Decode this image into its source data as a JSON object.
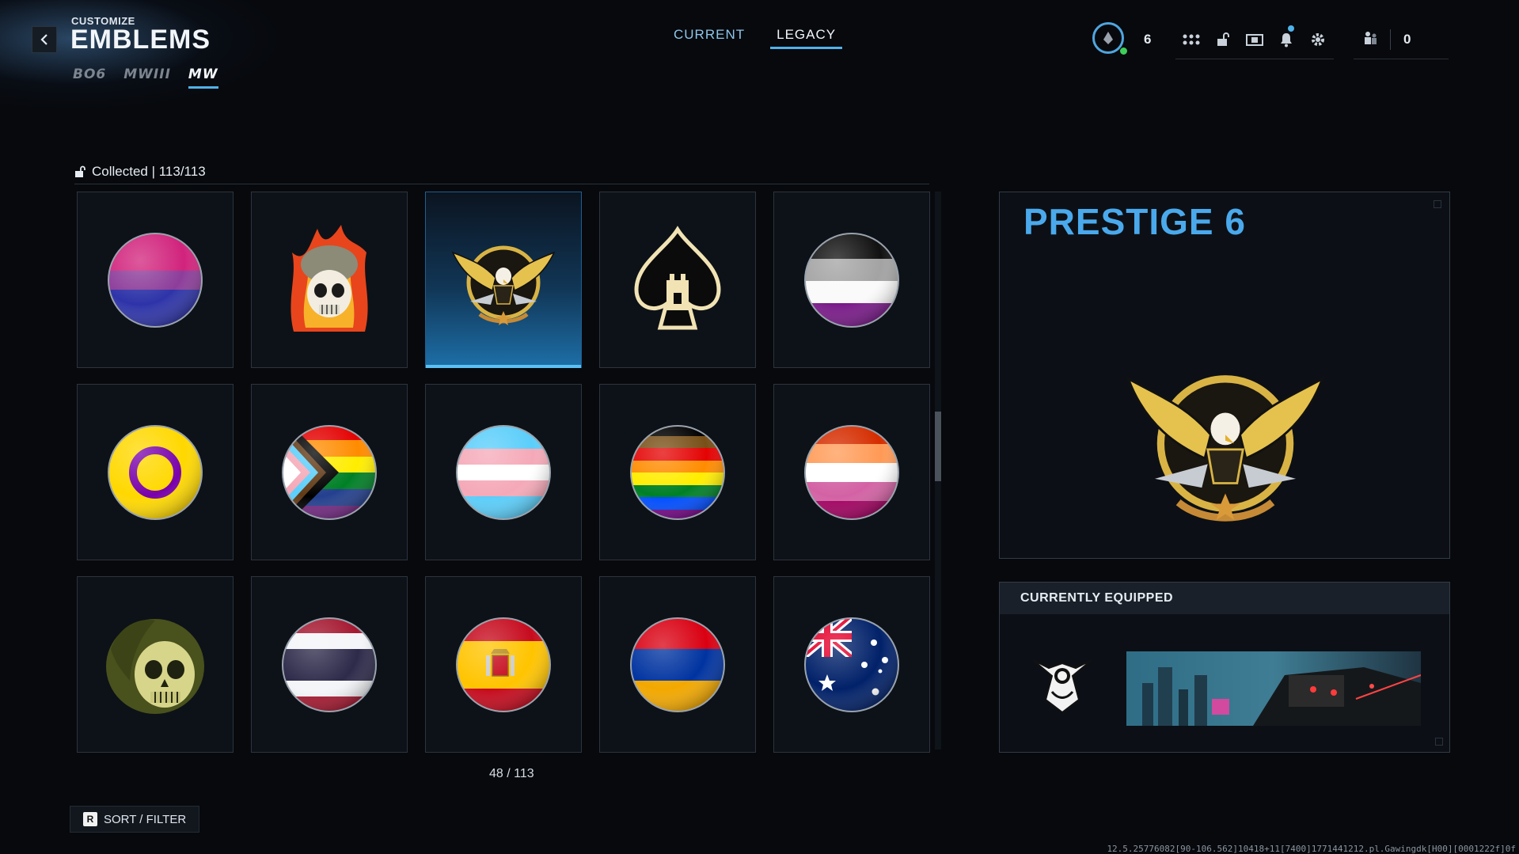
{
  "header": {
    "small_label": "CUSTOMIZE",
    "title": "EMBLEMS",
    "game_tabs": [
      {
        "label": "BO6",
        "active": false
      },
      {
        "label": "MWIII",
        "active": false
      },
      {
        "label": "MW",
        "active": true
      }
    ],
    "mode_tabs": [
      {
        "label": "CURRENT",
        "active": false
      },
      {
        "label": "LEGACY",
        "active": true
      }
    ]
  },
  "top_right": {
    "prestige_level": "6",
    "party_count": "0",
    "icons": [
      "grid-menu-icon",
      "unlock-icon",
      "store-icon",
      "bell-icon",
      "gear-icon"
    ]
  },
  "grid": {
    "collected_label": "Collected | 113/113",
    "page_count": "48 / 113",
    "selected_index": 2,
    "tiles": [
      {
        "emblem": "bisexual-flag-ball",
        "colors": [
          "#d1237c",
          "#8d3d9a",
          "#2e34a8"
        ]
      },
      {
        "emblem": "flaming-skull-helmet"
      },
      {
        "emblem": "prestige-6-eagle"
      },
      {
        "emblem": "ace-of-spades-tower"
      },
      {
        "emblem": "asexual-flag-ball",
        "colors": [
          "#111111",
          "#a3a3a3",
          "#ffffff",
          "#7a1b8a"
        ]
      },
      {
        "emblem": "intersex-flag-ball",
        "colors": [
          "#ffd800",
          "#7902aa"
        ]
      },
      {
        "emblem": "progress-pride-flag-ball"
      },
      {
        "emblem": "transgender-flag-ball",
        "colors": [
          "#5bcefa",
          "#f5a9b8",
          "#ffffff"
        ]
      },
      {
        "emblem": "philadelphia-pride-flag-ball"
      },
      {
        "emblem": "lesbian-flag-ball",
        "colors": [
          "#d52d00",
          "#ff9a56",
          "#ffffff",
          "#d362a4",
          "#a30262"
        ]
      },
      {
        "emblem": "ghost-skull-mask"
      },
      {
        "emblem": "thailand-flag-ball",
        "colors": [
          "#a51931",
          "#f4f5f8",
          "#2d2a4a"
        ]
      },
      {
        "emblem": "spain-flag-ball",
        "colors": [
          "#c60b1e",
          "#ffc400"
        ]
      },
      {
        "emblem": "armenia-flag-ball",
        "colors": [
          "#d90012",
          "#0033a0",
          "#f2a800"
        ]
      },
      {
        "emblem": "australia-flag-ball",
        "colors": [
          "#012169",
          "#ffffff",
          "#e4002b"
        ]
      }
    ]
  },
  "preview": {
    "title": "PRESTIGE 6"
  },
  "equipped": {
    "heading": "CURRENTLY EQUIPPED"
  },
  "footer": {
    "sort_key": "R",
    "sort_label": "SORT / FILTER",
    "build_info": "12.5.25776082[90-106.562]10418+11[7400]1771441212.pl.Gawingdk[H00][0001222f]0f"
  },
  "colors": {
    "accent": "#4fb2ea",
    "title_blue": "#4aa9ec",
    "background": "#07090d"
  }
}
